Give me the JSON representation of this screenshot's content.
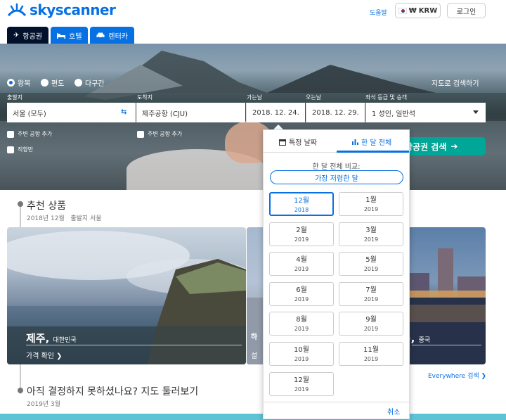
{
  "header": {
    "logo_text": "skyscanner",
    "help": "도움말",
    "currency": "KRW",
    "login": "로그인"
  },
  "tabs": [
    {
      "label": "항공권",
      "icon": "plane-icon",
      "active": true
    },
    {
      "label": "호텔",
      "icon": "bed-icon",
      "active": false
    },
    {
      "label": "렌터카",
      "icon": "car-icon",
      "active": false
    }
  ],
  "search": {
    "trip_types": [
      "왕복",
      "편도",
      "다구간"
    ],
    "map_search": "지도로 검색하기",
    "from_label": "출발지",
    "from_value": "서울 (모두)",
    "to_label": "도착지",
    "to_value": "제주공항 (CJU)",
    "depart_label": "가는날",
    "depart_value": "2018. 12. 24.",
    "return_label": "오는날",
    "return_value": "2018. 12. 29.",
    "class_label": "좌석 등급 및 승객",
    "class_value": "1 성인, 일반석",
    "nearby_from": "주변 공항 추가",
    "nearby_to": "주변 공항 추가",
    "direct": "직항만",
    "search_button": "항공권 검색"
  },
  "recommend": {
    "title": "추천 상품",
    "subtitle": "2018년 12월   출발지 서울",
    "card1_city": "제주,",
    "card1_country": "대한민국",
    "card1_link": "가격 확인",
    "card2_city": "하",
    "card2_title_tail": "진),",
    "card2_country": "중국",
    "card2_link": "설",
    "everywhere": "Everywhere 검색"
  },
  "undecided": {
    "title": "아직 결정하지 못하셨나요? 지도 둘러보기",
    "subtitle": "2019년 3월"
  },
  "popup": {
    "tab_specific": "특정 날짜",
    "tab_whole": "한 달 전체",
    "compare": "한 달 전체 비교:",
    "cheapest": "가장 저렴한 달",
    "months": [
      {
        "m": "12월",
        "y": "2018",
        "selected": true
      },
      {
        "m": "1월",
        "y": "2019",
        "selected": false
      },
      {
        "m": "2월",
        "y": "2019",
        "selected": false
      },
      {
        "m": "3월",
        "y": "2019",
        "selected": false
      },
      {
        "m": "4월",
        "y": "2019",
        "selected": false
      },
      {
        "m": "5월",
        "y": "2019",
        "selected": false
      },
      {
        "m": "6월",
        "y": "2019",
        "selected": false
      },
      {
        "m": "7월",
        "y": "2019",
        "selected": false
      },
      {
        "m": "8월",
        "y": "2019",
        "selected": false
      },
      {
        "m": "9월",
        "y": "2019",
        "selected": false
      },
      {
        "m": "10월",
        "y": "2019",
        "selected": false
      },
      {
        "m": "11월",
        "y": "2019",
        "selected": false
      },
      {
        "m": "12월",
        "y": "2019",
        "selected": false
      }
    ],
    "cancel": "취소"
  },
  "colors": {
    "brand": "#0770e3",
    "search_green": "#00a698",
    "tab_dark": "#02122c"
  }
}
